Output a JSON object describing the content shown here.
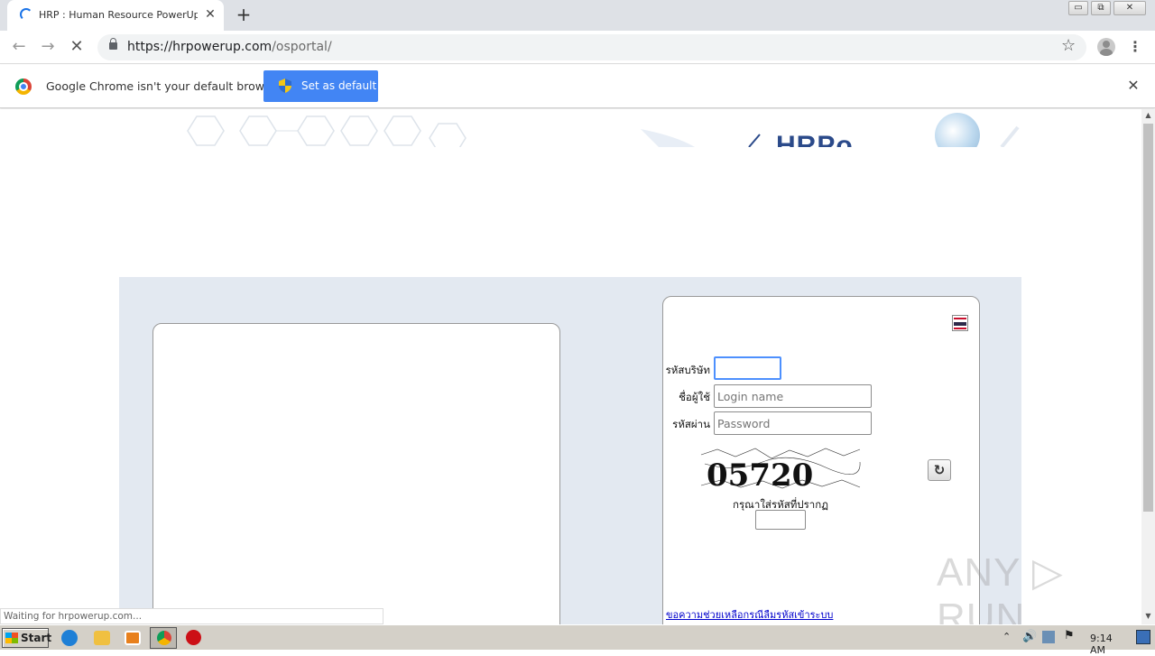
{
  "browser": {
    "tab_title": "HRP : Human Resource PowerUp for",
    "tab_close": "✕",
    "new_tab": "+",
    "url_host": "https://hrpowerup.com",
    "url_path": "/osportal/",
    "back": "←",
    "forward": "→",
    "stop": "✕",
    "star": "☆",
    "menu": "⋮",
    "window_min": "▭",
    "window_max": "⧉",
    "window_close": "✕"
  },
  "infobar": {
    "message": "Google Chrome isn't your default browser",
    "button_label": "Set as default",
    "close": "✕"
  },
  "page": {
    "banner_logo": "HRPo",
    "login": {
      "company_label": "รหัสบริษัท",
      "company_value": "",
      "login_label": "ชื่อผู้ใช้",
      "login_placeholder": "Login name",
      "password_label": "รหัสผ่าน",
      "password_placeholder": "Password",
      "captcha_text": "05720",
      "captcha_prompt": "กรุณาใส่รหัสที่ปรากฏ",
      "captcha_value": "",
      "refresh": "↻",
      "help_link": "ขอความช่วยเหลือกรณีลืมรหัสเข้าระบบ"
    },
    "status": "Waiting for hrpowerup.com...",
    "watermark": "ANY ▷ RUN"
  },
  "scrollbar": {
    "up": "▲",
    "down": "▼"
  },
  "taskbar": {
    "start_label": "Start",
    "tray_arrow": "⌃",
    "tray_sound": "🔊",
    "tray_flag": "⚑",
    "clock": "9:14 AM"
  },
  "colors": {
    "accent": "#4285f4",
    "panel_bg": "#e3e9f1",
    "link": "#0000cc"
  }
}
